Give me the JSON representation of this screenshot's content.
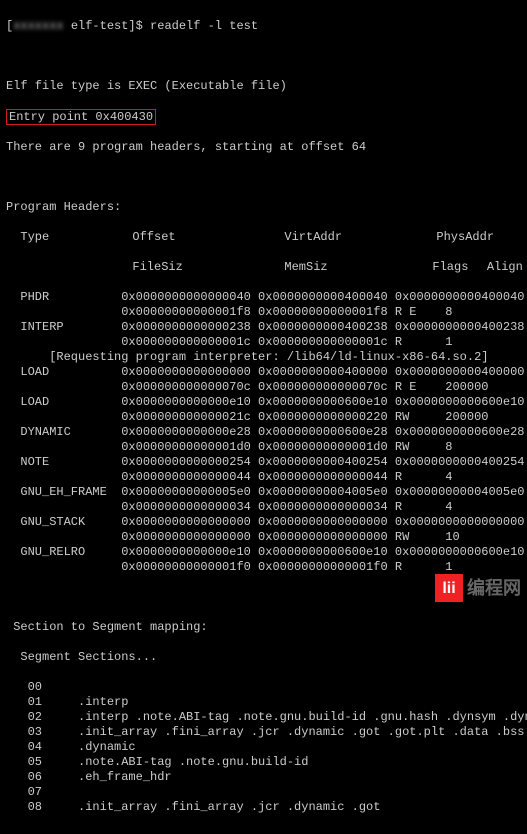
{
  "prompt": {
    "user_host": "[",
    "blurred": "xxxxxxx",
    "path": " elf-test]$ ",
    "cmd": "readelf -l test"
  },
  "header": {
    "file_type": "Elf file type is EXEC (Executable file)",
    "entry_point": "Entry point 0x400430",
    "num_headers": "There are 9 program headers, starting at offset 64"
  },
  "ph_title": "Program Headers:",
  "cols_a": [
    "Type",
    "Offset",
    "VirtAddr",
    "PhysAddr"
  ],
  "cols_b": [
    "",
    "FileSiz",
    "MemSiz",
    "Flags",
    "Align"
  ],
  "headers": [
    {
      "type": "PHDR",
      "offset": "0x0000000000000040",
      "virt": "0x0000000000400040",
      "phys": "0x0000000000400040",
      "filesz": "0x00000000000001f8",
      "memsz": "0x00000000000001f8",
      "flags": "R E",
      "align": "8"
    },
    {
      "type": "INTERP",
      "offset": "0x0000000000000238",
      "virt": "0x0000000000400238",
      "phys": "0x0000000000400238",
      "filesz": "0x000000000000001c",
      "memsz": "0x000000000000001c",
      "flags": "R",
      "align": "1",
      "note": "[Requesting program interpreter: /lib64/ld-linux-x86-64.so.2]"
    },
    {
      "type": "LOAD",
      "offset": "0x0000000000000000",
      "virt": "0x0000000000400000",
      "phys": "0x0000000000400000",
      "filesz": "0x000000000000070c",
      "memsz": "0x000000000000070c",
      "flags": "R E",
      "align": "200000"
    },
    {
      "type": "LOAD",
      "offset": "0x0000000000000e10",
      "virt": "0x0000000000600e10",
      "phys": "0x0000000000600e10",
      "filesz": "0x000000000000021c",
      "memsz": "0x0000000000000220",
      "flags": "RW",
      "align": "200000"
    },
    {
      "type": "DYNAMIC",
      "offset": "0x0000000000000e28",
      "virt": "0x0000000000600e28",
      "phys": "0x0000000000600e28",
      "filesz": "0x00000000000001d0",
      "memsz": "0x00000000000001d0",
      "flags": "RW",
      "align": "8"
    },
    {
      "type": "NOTE",
      "offset": "0x0000000000000254",
      "virt": "0x0000000000400254",
      "phys": "0x0000000000400254",
      "filesz": "0x0000000000000044",
      "memsz": "0x0000000000000044",
      "flags": "R",
      "align": "4"
    },
    {
      "type": "GNU_EH_FRAME",
      "offset": "0x00000000000005e0",
      "virt": "0x00000000004005e0",
      "phys": "0x00000000004005e0",
      "filesz": "0x0000000000000034",
      "memsz": "0x0000000000000034",
      "flags": "R",
      "align": "4"
    },
    {
      "type": "GNU_STACK",
      "offset": "0x0000000000000000",
      "virt": "0x0000000000000000",
      "phys": "0x0000000000000000",
      "filesz": "0x0000000000000000",
      "memsz": "0x0000000000000000",
      "flags": "RW",
      "align": "10"
    },
    {
      "type": "GNU_RELRO",
      "offset": "0x0000000000000e10",
      "virt": "0x0000000000600e10",
      "phys": "0x0000000000600e10",
      "filesz": "0x00000000000001f0",
      "memsz": "0x00000000000001f0",
      "flags": "R",
      "align": "1"
    }
  ],
  "seg_title": " Section to Segment mapping:",
  "seg_sub": "  Segment Sections...",
  "segments": [
    {
      "num": "00",
      "sections": ""
    },
    {
      "num": "01",
      "sections": ".interp"
    },
    {
      "num": "02",
      "sections": ".interp .note.ABI-tag .note.gnu.build-id .gnu.hash .dynsym .dynst"
    },
    {
      "num": "03",
      "sections": ".init_array .fini_array .jcr .dynamic .got .got.plt .data .bss"
    },
    {
      "num": "04",
      "sections": ".dynamic"
    },
    {
      "num": "05",
      "sections": ".note.ABI-tag .note.gnu.build-id"
    },
    {
      "num": "06",
      "sections": ".eh_frame_hdr"
    },
    {
      "num": "07",
      "sections": ""
    },
    {
      "num": "08",
      "sections": ".init_array .fini_array .jcr .dynamic .got"
    }
  ],
  "watermark": {
    "logo": "lii",
    "text": "编程网"
  }
}
